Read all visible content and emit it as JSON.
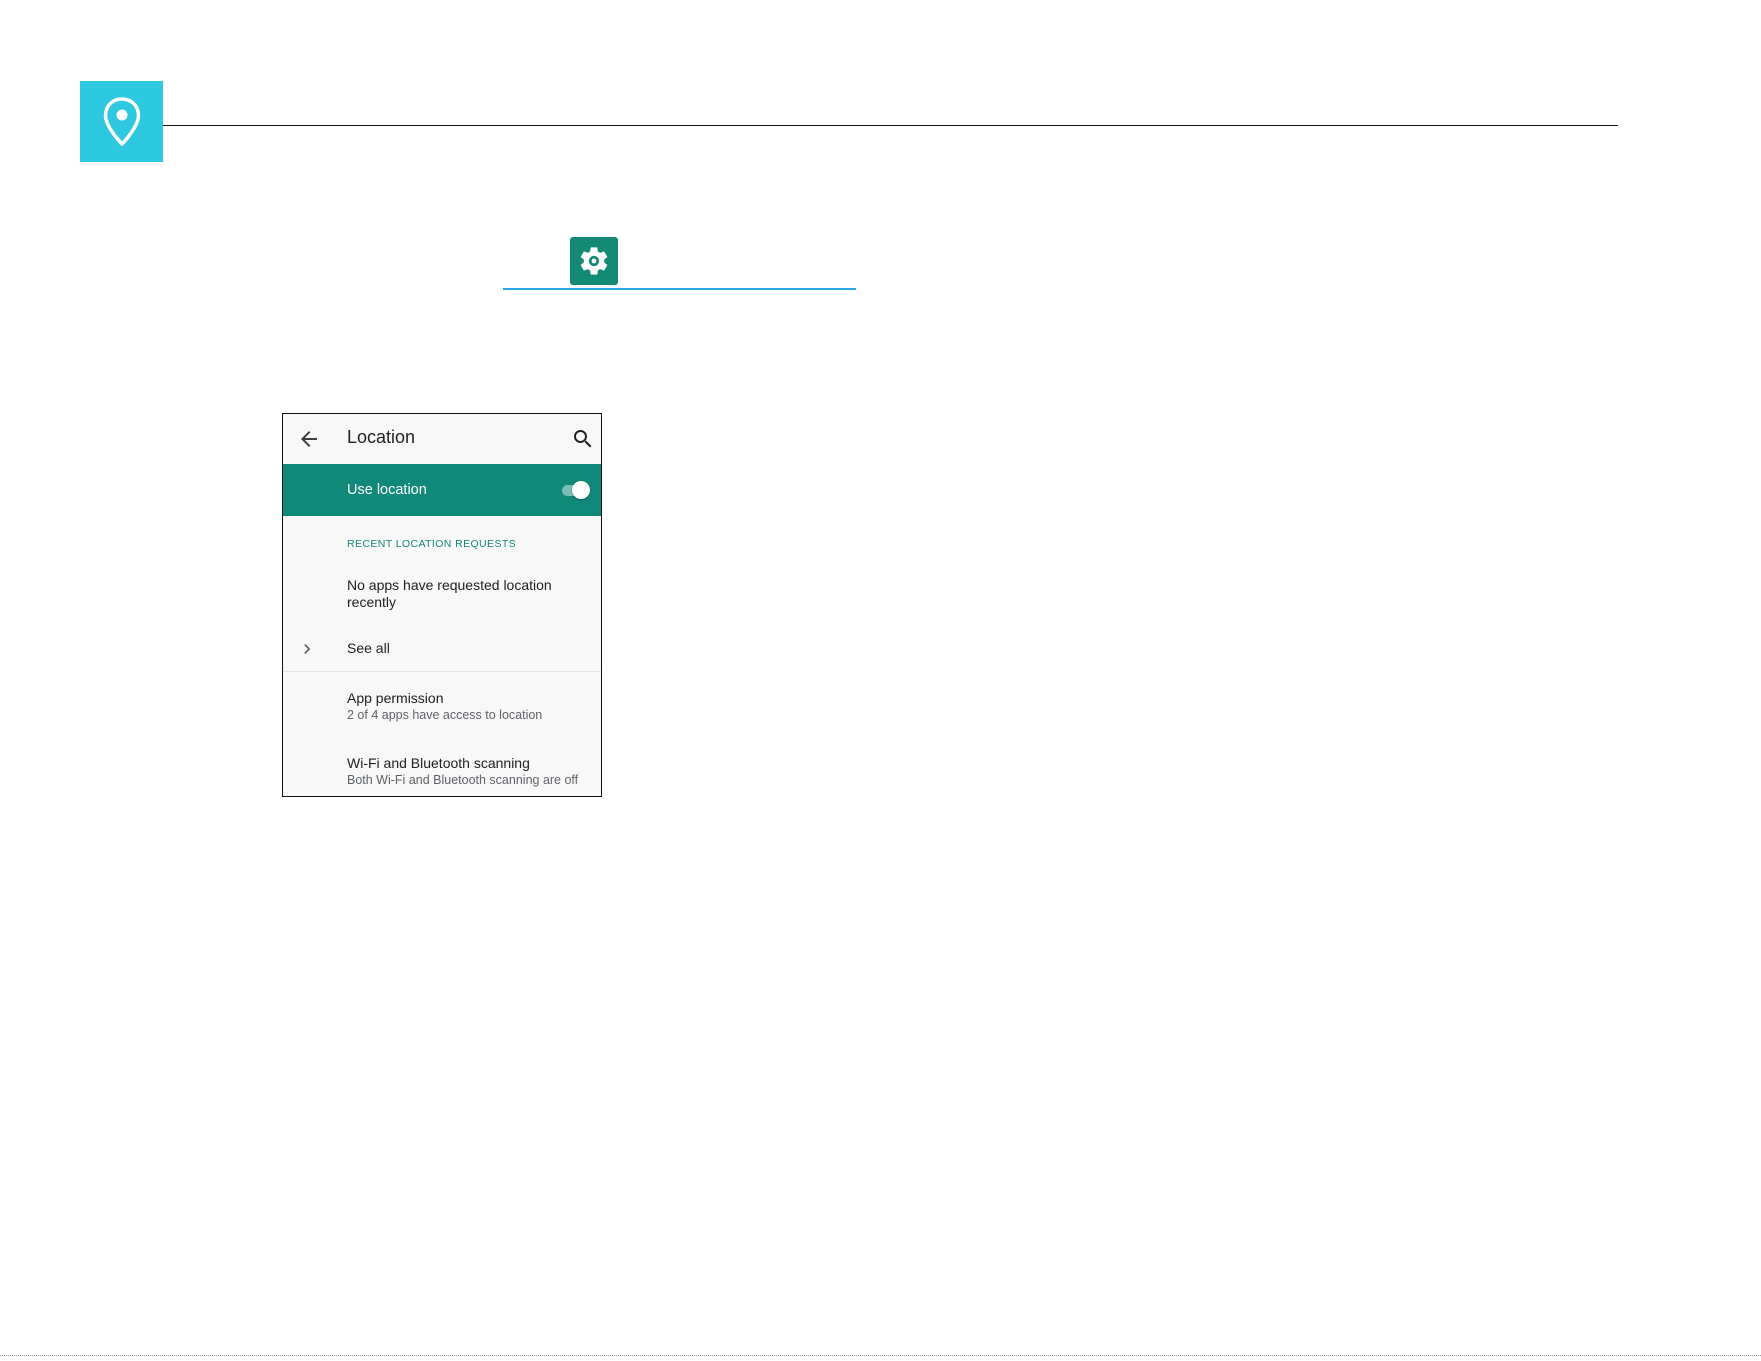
{
  "colors": {
    "badge": "#2ec8e0",
    "settings_icon": "#138a76",
    "settings_underline": "#2aa8e8",
    "master_switch_bg": "#11897a",
    "section_header": "#11897a"
  },
  "icons": {
    "badge": "location-pin-icon",
    "settings": "gear-icon",
    "back": "arrow-back-icon",
    "search": "search-icon",
    "expand": "chevron-right-icon"
  },
  "screen": {
    "appbar": {
      "title": "Location"
    },
    "master_switch": {
      "label": "Use location",
      "checked": true
    },
    "recent_requests": {
      "header": "RECENT LOCATION REQUESTS",
      "empty_line1": "No apps have requested location",
      "empty_line2": "recently",
      "see_all": "See all"
    },
    "app_permission": {
      "title": "App permission",
      "summary": "2 of 4 apps have access to location"
    },
    "scanning": {
      "title": "Wi-Fi and Bluetooth scanning",
      "summary": "Both Wi-Fi and Bluetooth scanning are off"
    }
  }
}
